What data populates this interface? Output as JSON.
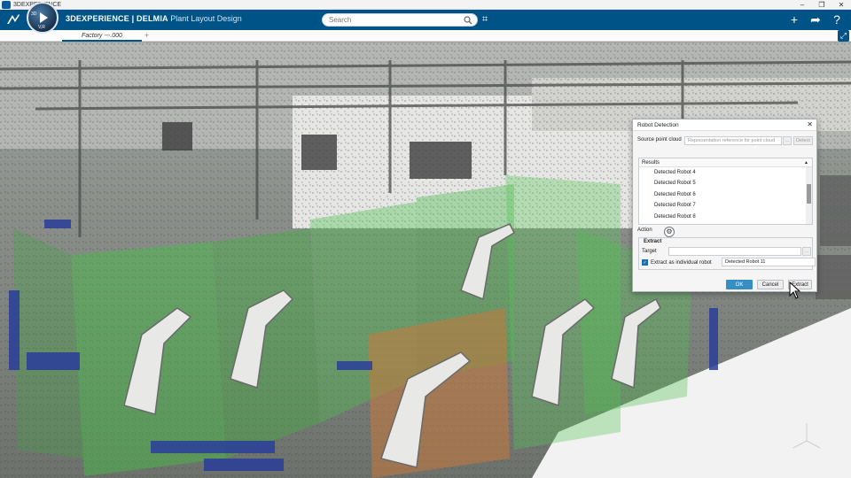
{
  "os": {
    "title": "3DEXPERIENCE"
  },
  "app": {
    "brand": "3DEXPERIENCE | DELMIA",
    "name": "Plant Layout Design",
    "compass_nums": "3D",
    "compass_ver": "V,R"
  },
  "search": {
    "placeholder": "Search"
  },
  "tabs": [
    {
      "label": "Factory ---.000"
    }
  ],
  "tab_add": "+",
  "dialog": {
    "title": "Robot Detection",
    "source_label": "Source point cloud",
    "source_placeholder": "Representation reference for point cloud",
    "source_more": "...",
    "detect_label": "Detect",
    "results_label": "Results",
    "results": [
      "Detected Robot 4",
      "Detected Robot 5",
      "Detected Robot 6",
      "Detected Robot 7",
      "Detected Robot 8"
    ],
    "action_label": "Action",
    "extract_group": "Extract",
    "target_label": "Target",
    "target_more": "...",
    "extract_individual_label": "Extract as individual robot",
    "extract_individual_checked": true,
    "extract_name_value": "Detected Robot 11",
    "ok_label": "OK",
    "cancel_label": "Cancel",
    "extract_label": "Extract"
  },
  "colors": {
    "app_bar": "#005386",
    "ok_button": "#368ec4",
    "detected_box_green": "#43c043",
    "selected_box_orange": "#c8783a"
  }
}
